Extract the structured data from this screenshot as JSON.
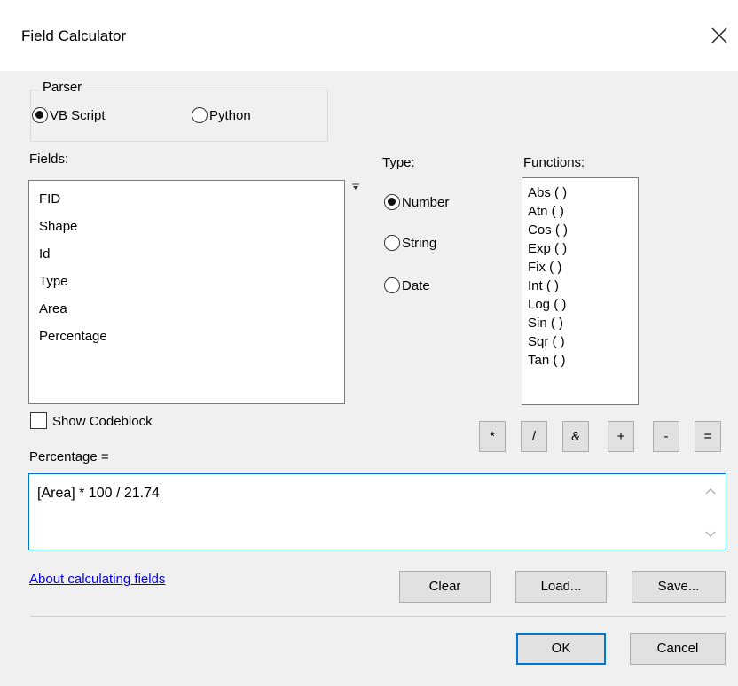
{
  "window": {
    "title": "Field Calculator",
    "close_icon": "close-icon"
  },
  "parser": {
    "label": "Parser",
    "options": [
      {
        "label": "VB Script",
        "selected": true
      },
      {
        "label": "Python",
        "selected": false
      }
    ]
  },
  "fields": {
    "label": "Fields:",
    "items": [
      "FID",
      "Shape",
      "Id",
      "Type",
      "Area",
      "Percentage"
    ]
  },
  "type": {
    "label": "Type:",
    "options": [
      {
        "label": "Number",
        "selected": true
      },
      {
        "label": "String",
        "selected": false
      },
      {
        "label": "Date",
        "selected": false
      }
    ]
  },
  "functions": {
    "label": "Functions:",
    "items": [
      "Abs ( )",
      "Atn ( )",
      "Cos ( )",
      "Exp ( )",
      "Fix ( )",
      "Int ( )",
      "Log ( )",
      "Sin ( )",
      "Sqr ( )",
      "Tan ( )"
    ]
  },
  "codeblock": {
    "label": "Show Codeblock",
    "checked": false
  },
  "operators": [
    "*",
    "/",
    "&",
    "+",
    "-",
    "="
  ],
  "expression": {
    "label": "Percentage =",
    "value": "[Area] * 100 / 21.74"
  },
  "help_link": "About calculating fields",
  "buttons": {
    "clear": "Clear",
    "load": "Load...",
    "save": "Save...",
    "ok": "OK",
    "cancel": "Cancel"
  },
  "colors": {
    "accent": "#0078d7",
    "link": "#0000ee",
    "dialog_bg": "#f0f0f0"
  }
}
